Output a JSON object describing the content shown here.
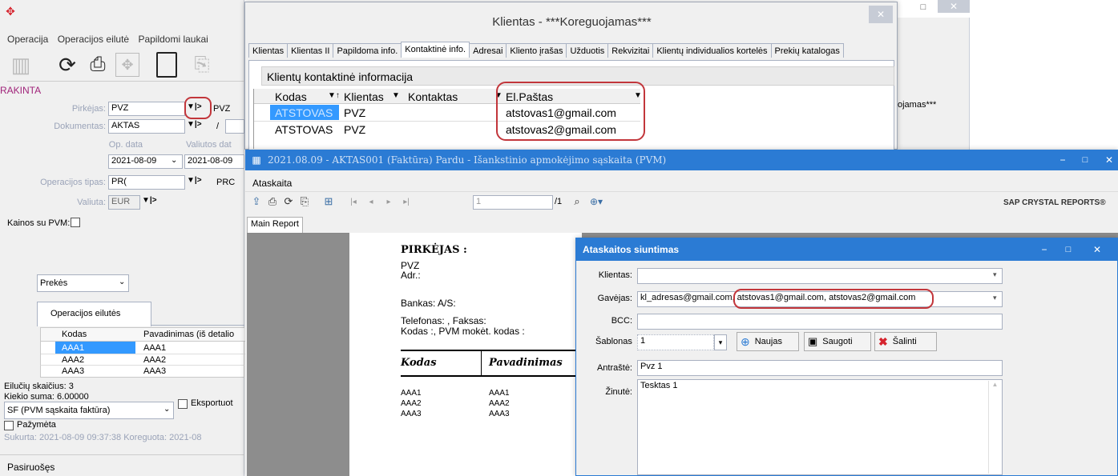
{
  "main": {
    "menu": [
      "Operacija",
      "Operacijos eilutė",
      "Papildomi laukai"
    ],
    "rakinta": "RAKINTA",
    "fields": {
      "pirkejas_label": "Pirkėjas:",
      "pirkejas_value": "PVZ",
      "pirkejas_side": "PVZ",
      "dokumentas_label": "Dokumentas:",
      "dokumentas_value": "AKTAS",
      "dokumentas_side": "/",
      "op_data_label": "Op. data",
      "valiutos_data_label": "Valiutos dat",
      "op_data_value": "2021-08-09",
      "valiutos_data_value": "2021-08-09",
      "op_tipas_label": "Operacijos tipas:",
      "op_tipas_value": "PR(",
      "op_tipas_side": "PRC",
      "valiuta_label": "Valiuta:",
      "valiuta_value": "EUR",
      "kainos_label": "Kainos su PVM:"
    },
    "prekes": "Prekės",
    "eilutes_tab": "Operacijos eilutės",
    "grid_headers": [
      "Kodas",
      "Pavadinimas (iš detalio"
    ],
    "grid_rows": [
      [
        "AAA1",
        "AAA1"
      ],
      [
        "AAA2",
        "AAA2"
      ],
      [
        "AAA3",
        "AAA3"
      ]
    ],
    "eiluciu": "Eilučių skaičius: 3",
    "kiekio": "Kiekio suma: 6.00000",
    "sf_value": "SF (PVM sąskaita faktūra)",
    "eksportuot": "Eksportuot",
    "pazymeta": "Pažymėta",
    "sukurta": "Sukurta: 2021-08-09 09:37:38 Koreguota: 2021-08",
    "status": "Pasiruošęs"
  },
  "client": {
    "title": "Klientas - ***Koreguojamas***",
    "tabs": [
      "Klientas",
      "Klientas II",
      "Papildoma info.",
      "Kontaktinė info.",
      "Adresai",
      "Kliento įrašas",
      "Užduotis",
      "Rekvizitai",
      "Klientų individualios kortelės",
      "Prekių katalogas"
    ],
    "section": "Klientų kontaktinė informacija",
    "headers": [
      "Kodas",
      "Klientas",
      "Kontaktas",
      "El.Paštas"
    ],
    "rows": [
      [
        "ATSTOVAS",
        "PVZ",
        "",
        "atstovas1@gmail.com"
      ],
      [
        "ATSTOVAS",
        "PVZ",
        "",
        "atstovas2@gmail.com"
      ]
    ],
    "side_text": "ojamas***"
  },
  "report": {
    "title": "2021.08.09 - AKTAS001 (Faktūra) Pardu - Išankstinio apmokėjimo sąskaita (PVM)",
    "menu": "Ataskaita",
    "page_input": "1",
    "page_total": "/1",
    "brand": "SAP CRYSTAL REPORTS®",
    "tab": "Main Report",
    "content": {
      "pirkejas": "PIRKĖJAS :",
      "lines": [
        "PVZ",
        "Adr.:"
      ],
      "bankas": "Bankas: A/S:",
      "telefonas": "Telefonas: , Faksas:",
      "kodas_line": "Kodas :, PVM mokėt. kodas :",
      "col_kodas": "Kodas",
      "col_pav": "Pavadinimas",
      "rows": [
        [
          "AAA1",
          "AAA1"
        ],
        [
          "AAA2",
          "AAA2"
        ],
        [
          "AAA3",
          "AAA3"
        ]
      ]
    }
  },
  "send": {
    "title": "Ataskaitos siuntimas",
    "klientas_label": "Klientas:",
    "klientas_value": "",
    "gavejas_label": "Gavėjas:",
    "gavejas_value": "kl_adresas@gmail.com, atstovas1@gmail.com, atstovas2@gmail.com",
    "bcc_label": "BCC:",
    "bcc_value": "",
    "sablonas_label": "Šablonas",
    "sablonas_value": "1",
    "naujas": "Naujas",
    "saugoti": "Saugoti",
    "salinti": "Šalinti",
    "antraste_label": "Antraštė:",
    "antraste_value": "Pvz 1",
    "zinute_label": "Žinutė:",
    "zinute_value": "Tesktas 1"
  },
  "colors": {
    "accent_blue": "#2b7bd4",
    "highlight_red": "#c2363b",
    "label_blue": "#9aa3b8"
  }
}
